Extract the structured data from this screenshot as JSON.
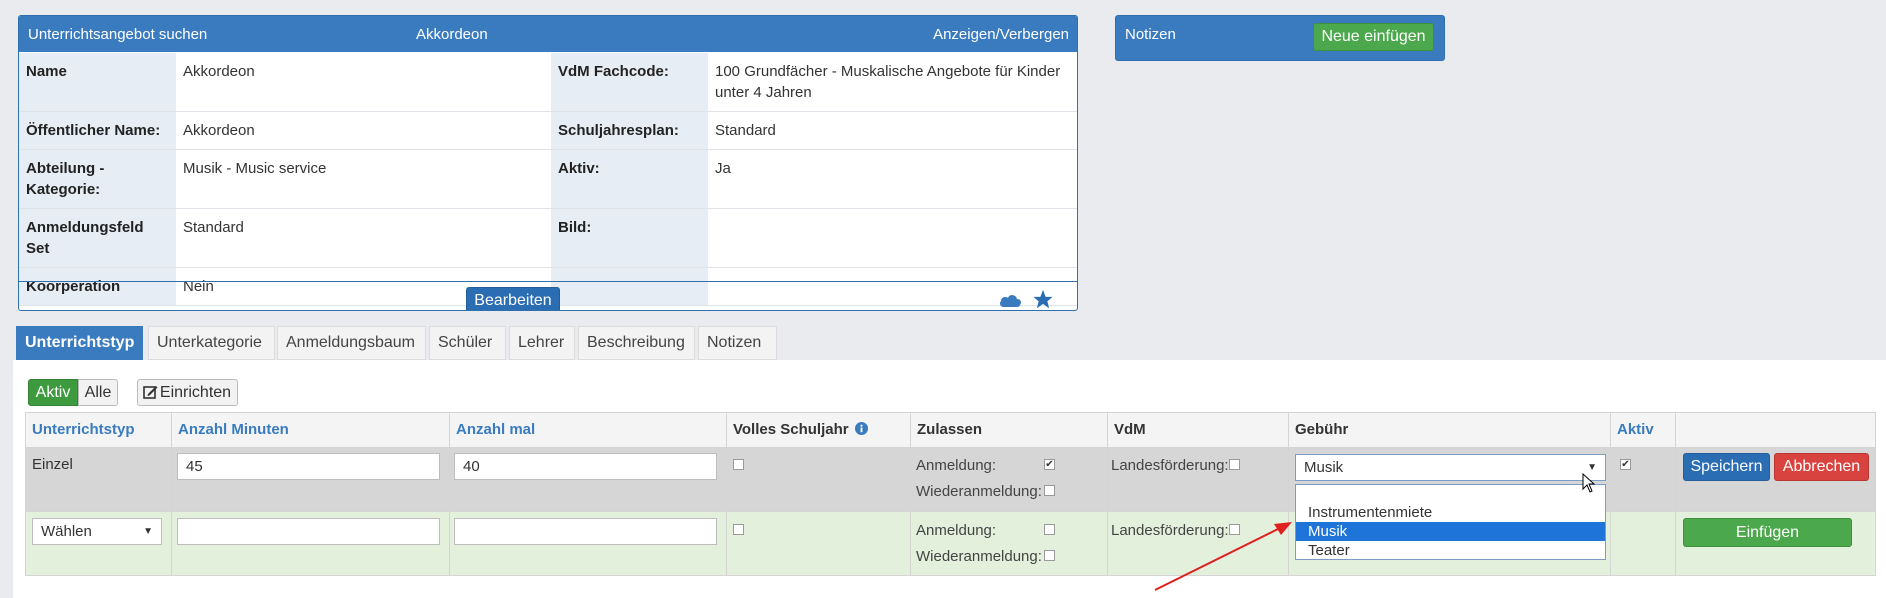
{
  "panel": {
    "header_left": "Unterrichtsangebot suchen",
    "header_center": "Akkordeon",
    "header_right": "Anzeigen/Verbergen",
    "rows": [
      {
        "l1": "Name",
        "v1": "Akkordeon",
        "l2": "VdM Fachcode:",
        "v2": "100 Grundfächer - Muskalische Angebote für Kinder unter 4 Jahren"
      },
      {
        "l1": "Öffentlicher Name:",
        "v1": "Akkordeon",
        "l2": "Schuljahresplan:",
        "v2": "Standard"
      },
      {
        "l1": "Abteilung - Kategorie:",
        "v1": "Musik - Music service",
        "l2": "Aktiv:",
        "v2": "Ja"
      },
      {
        "l1": "Anmeldungsfeld Set",
        "v1": "Standard",
        "l2": "Bild:",
        "v2": ""
      },
      {
        "l1": "Koorperation",
        "v1": "Nein",
        "l2": "",
        "v2": ""
      }
    ],
    "edit_label": "Bearbeiten"
  },
  "notes": {
    "title": "Notizen",
    "add_label": "Neue einfügen"
  },
  "tabs": [
    "Unterrichtstyp",
    "Unterkategorie",
    "Anmeldungsbaum",
    "Schüler",
    "Lehrer",
    "Beschreibung",
    "Notizen"
  ],
  "filter": {
    "active": "Aktiv",
    "all": "Alle",
    "setup": "Einrichten"
  },
  "table": {
    "headers": [
      "Unterrichtstyp",
      "Anzahl Minuten",
      "Anzahl mal",
      "Volles Schuljahr",
      "Zulassen",
      "VdM",
      "Gebühr",
      "Aktiv"
    ],
    "row1": {
      "type": "Einzel",
      "minutes": "45",
      "times": "40",
      "anmeldung": "Anmeldung:",
      "wiederanmeldung": "Wiederanmeldung:",
      "landes": "Landesförderung:",
      "fee": "Musik",
      "save": "Speichern",
      "cancel": "Abbrechen"
    },
    "row2": {
      "select": "Wählen",
      "minutes": "",
      "times": "",
      "anmeldung": "Anmeldung:",
      "wiederanmeldung": "Wiederanmeldung:",
      "landes": "Landesförderung:",
      "insert": "Einfügen"
    }
  },
  "fee_options": [
    "",
    "Instrumentenmiete",
    "Musik",
    "Teater"
  ],
  "colors": {
    "primary": "#3a7bbf",
    "success": "#4ca84c",
    "danger": "#d9433f",
    "selection": "#1e74d9"
  }
}
